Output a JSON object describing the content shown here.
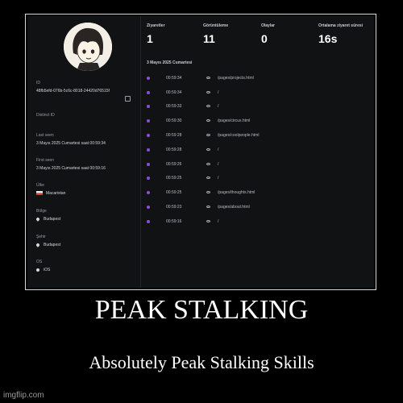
{
  "profile": {
    "id_label": "ID",
    "id_value": "48fb5efd-076b-5c6c-8018-24420d76515f",
    "distinct_label": "Distinct ID",
    "last_seen_label": "Last seen",
    "last_seen_value": "3 Mayıs 2025 Cumartesi saat 00:59:34",
    "first_seen_label": "First seen",
    "first_seen_value": "3 Mayıs 2025 Cumartesi saat 00:59:16",
    "country_label": "Ülke",
    "country_value": "Macaristan",
    "region_label": "Bölge",
    "region_value": "Budapest",
    "city_label": "Şehir",
    "city_value": "Budapest",
    "os_label": "OS",
    "os_value": "iOS"
  },
  "stats": [
    {
      "label": "Ziyaretler",
      "value": "1"
    },
    {
      "label": "Görüntüleme",
      "value": "11"
    },
    {
      "label": "Olaylar",
      "value": "0"
    },
    {
      "label": "Ortalama ziyaret süresi",
      "value": "16s"
    }
  ],
  "activity": {
    "date": "3 Mayıs 2025 Cumartesi",
    "rows": [
      {
        "time": "00:59:34",
        "path": "/pages/projects.html"
      },
      {
        "time": "00:59:34",
        "path": "/"
      },
      {
        "time": "00:59:33",
        "path": "/"
      },
      {
        "time": "00:59:30",
        "path": "/pages/circus.html"
      },
      {
        "time": "00:59:28",
        "path": "/pages/coolpeople.html"
      },
      {
        "time": "00:59:28",
        "path": "/"
      },
      {
        "time": "00:59:26",
        "path": "/"
      },
      {
        "time": "00:59:25",
        "path": "/"
      },
      {
        "time": "00:59:25",
        "path": "/pages/thoughts.html"
      },
      {
        "time": "00:59:23",
        "path": "/pages/about.html"
      },
      {
        "time": "00:59:16",
        "path": "/"
      }
    ]
  },
  "meme": {
    "title": "PEAK STALKING",
    "subtitle": "Absolutely Peak Stalking Skills",
    "watermark": "imgflip.com"
  },
  "colors": {
    "background": "#111214",
    "accent_dot": "#8b4ddb"
  }
}
